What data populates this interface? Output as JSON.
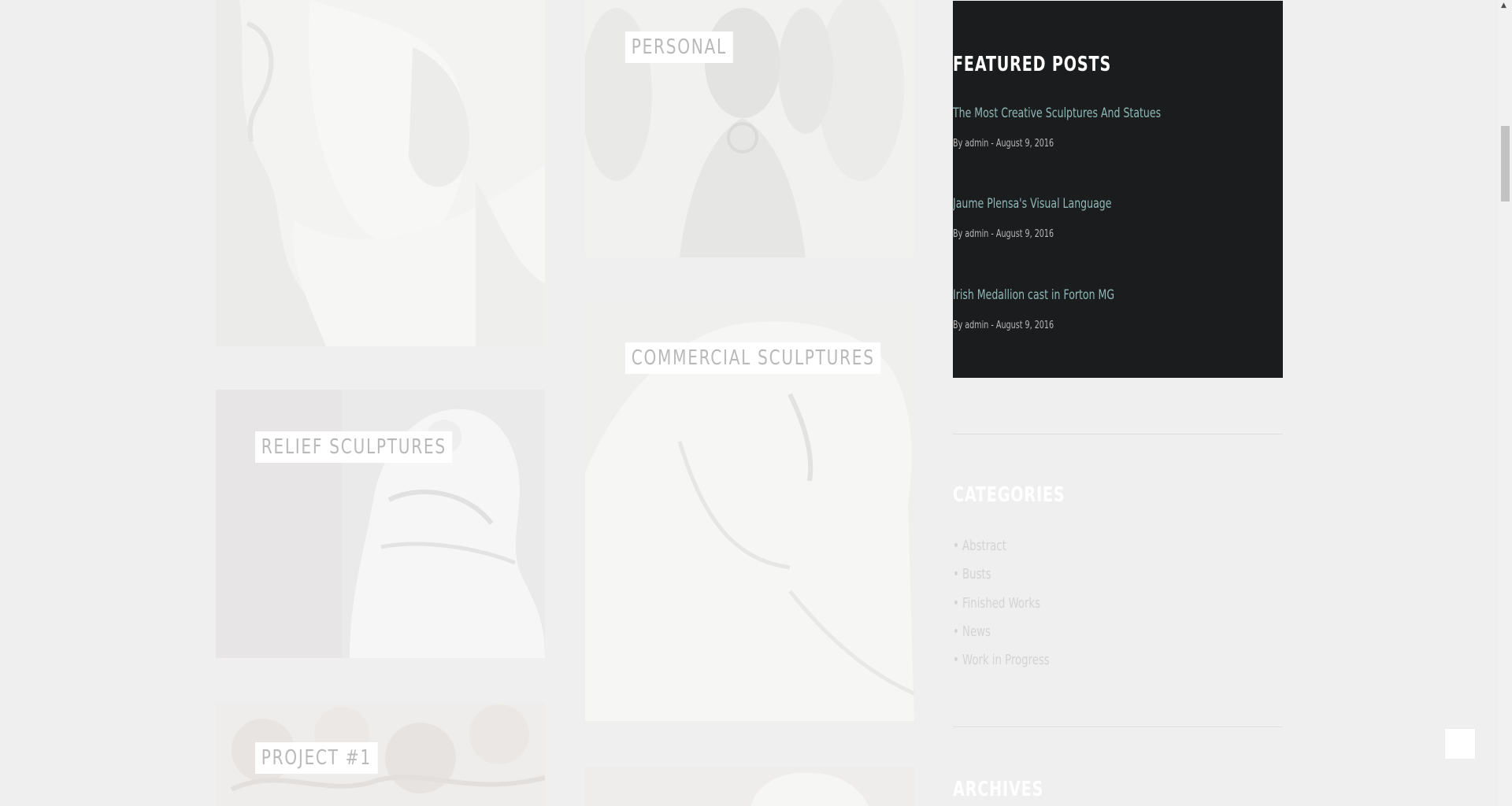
{
  "portfolio": {
    "tiles": [
      {
        "label": ""
      },
      {
        "label": "PERSONAL"
      },
      {
        "label": "RELIEF SCULPTURES"
      },
      {
        "label": "COMMERCIAL SCULPTURES"
      },
      {
        "label": "PROJECT #1"
      },
      {
        "label": ""
      }
    ]
  },
  "sidebar": {
    "featured": {
      "title": "FEATURED POSTS",
      "posts": [
        {
          "title": "The Most Creative Sculptures And Statues",
          "meta": "By admin - August 9, 2016"
        },
        {
          "title": "Jaume Plensa's Visual Language",
          "meta": "By admin - August 9, 2016"
        },
        {
          "title": "Irish Medallion cast in Forton MG",
          "meta": "By admin - August 9, 2016"
        }
      ]
    },
    "categories": {
      "title": "CATEGORIES",
      "items": [
        {
          "label": "Abstract"
        },
        {
          "label": "Busts"
        },
        {
          "label": "Finished Works"
        },
        {
          "label": "News"
        },
        {
          "label": "Work in Progress"
        }
      ]
    },
    "archives": {
      "title": "ARCHIVES"
    }
  },
  "colors": {
    "page_bg": "#efefef",
    "dark_panel": "#1b1c1e",
    "post_link": "#8fb8b6",
    "tag_text": "#b9b9b9"
  },
  "icons": {
    "scroll_up": "caret-up-icon",
    "back_to_top": "arrow-up-icon"
  }
}
